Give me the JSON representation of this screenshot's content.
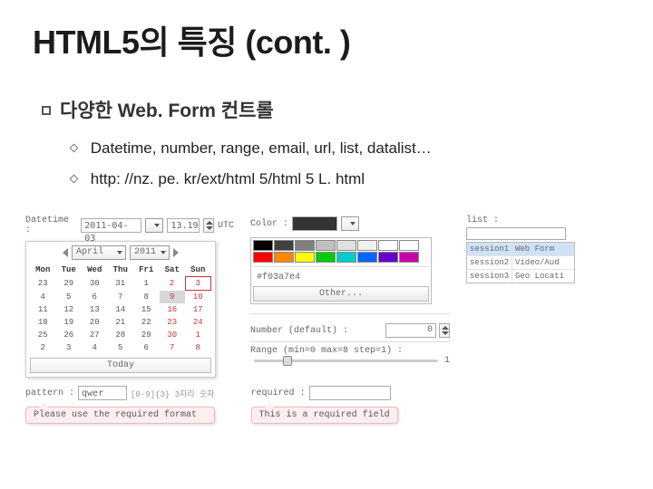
{
  "title": "HTML5의 특징 (cont. )",
  "bullet": {
    "label": "다양한 Web. Form 컨트롤"
  },
  "subs": [
    "Datetime, number, range, email, url, list, datalist…",
    "http: //nz. pe. kr/ext/html 5/html 5 L. html"
  ],
  "demo": {
    "datetime": {
      "label": "Datetime :",
      "date_value": "2011-04-03",
      "time_value": "13.19",
      "tz": "UTC",
      "month": "April",
      "year": "2011",
      "days": [
        "Mon",
        "Tue",
        "Wed",
        "Thu",
        "Fri",
        "Sat",
        "Sun"
      ],
      "weeks": [
        [
          "23",
          "29",
          "30",
          "31",
          "1",
          "2",
          "3"
        ],
        [
          "4",
          "5",
          "6",
          "7",
          "8",
          "9",
          "10"
        ],
        [
          "11",
          "12",
          "13",
          "14",
          "15",
          "16",
          "17"
        ],
        [
          "18",
          "19",
          "20",
          "21",
          "22",
          "23",
          "24"
        ],
        [
          "25",
          "26",
          "27",
          "28",
          "29",
          "30",
          "1"
        ],
        [
          "2",
          "3",
          "4",
          "5",
          "6",
          "7",
          "8"
        ]
      ],
      "today": "Today"
    },
    "color": {
      "label": "Color :",
      "rows": [
        [
          "#000000",
          "#404040",
          "#808080",
          "#c0c0c0",
          "#e0e0e0",
          "#f0f0f0",
          "#ffffff",
          "#ffffff"
        ],
        [
          "#ff0000",
          "#ff8800",
          "#ffff00",
          "#00cc00",
          "#00cccc",
          "#0066ff",
          "#6600cc",
          "#cc00aa"
        ]
      ],
      "hex": "#f03a7e4",
      "other": "Other..."
    },
    "number": {
      "label": "Number (default) :",
      "value": "0"
    },
    "range": {
      "label": "Range (min=0 max=8 step=1) :",
      "value": "1"
    },
    "list": {
      "label": "list :",
      "rows": [
        {
          "k": "session1",
          "v": "Web Form"
        },
        {
          "k": "session2",
          "v": "Video/Aud"
        },
        {
          "k": "session3",
          "v": "Geo Locati"
        }
      ]
    },
    "pattern": {
      "label": "pattern :",
      "value": "qwer",
      "hint": "[0-9]{3} 3자리 숫자",
      "tooltip": "Please use the required format"
    },
    "required": {
      "label": "required :",
      "tooltip": "This is a required field"
    }
  }
}
